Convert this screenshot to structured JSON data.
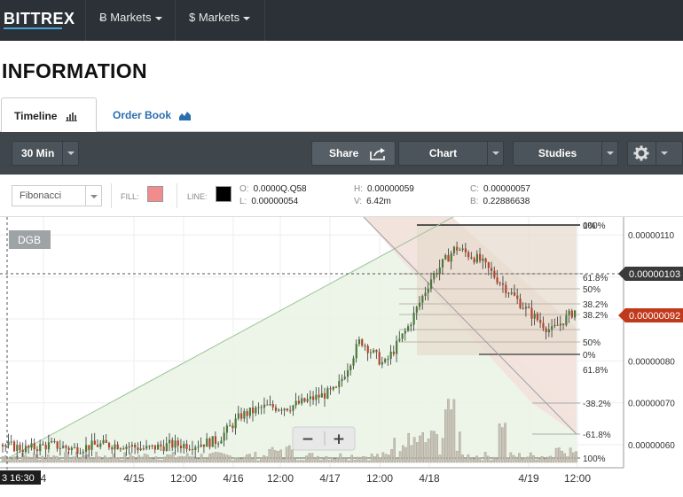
{
  "nav": {
    "brand": "BITTREX",
    "markets_btc": "Ƀ Markets",
    "markets_usd": "$ Markets"
  },
  "page": {
    "title": "INFORMATION"
  },
  "tabs": {
    "timeline": "Timeline",
    "order_book": "Order Book"
  },
  "toolbar": {
    "interval": "30 Min",
    "share": "Share",
    "chart": "Chart",
    "studies": "Studies"
  },
  "drawing": {
    "tool": "Fibonacci",
    "fill_label": "FILL:",
    "line_label": "LINE:",
    "fill_color": "#f08c8c",
    "line_color": "#000000"
  },
  "ohlc": {
    "o_label": "O:",
    "o_value": "0.0000Q.Q58",
    "l_label": "L:",
    "l_value": "0.00000054",
    "h_label": "H:",
    "h_value": "0.00000059",
    "v_label": "V:",
    "v_value": "6.42m",
    "c_label": "C:",
    "c_value": "0.00000057",
    "b_label": "B:",
    "b_value": "0.22886638"
  },
  "chart": {
    "symbol": "DGB",
    "crosshair_price": "0.00000103",
    "last_price": "0.00000092",
    "crosshair_time": "3 16:30",
    "accent_colors": {
      "last_price": "#c0391b",
      "crosshair": "#3a3a3a",
      "up": "#4a7a3a",
      "down": "#b5442a"
    },
    "fib_upper": [
      "100%",
      "61.8%",
      "50%",
      "38.2%",
      "0%"
    ],
    "fib_lower": [
      "0%",
      "38.2%",
      "50%",
      "61.8%",
      "100%"
    ],
    "fib_extra": [
      "61.8%",
      "-38.2%",
      "-61.8%",
      "100%"
    ],
    "zoom_out": "−",
    "zoom_in": "+"
  },
  "chart_data": {
    "type": "line",
    "title": "",
    "series": [],
    "x_ticks": [
      "4",
      "4/15",
      "12:00",
      "4/16",
      "12:00",
      "4/17",
      "12:00",
      "4/18",
      "4/19",
      "12:00"
    ],
    "y_ticks": [
      "0.00000110",
      "0.00000100",
      "0.00000090",
      "0.00000080",
      "0.00000070",
      "0.00000060"
    ],
    "ylim": [
      5.6e-07,
      1.13e-06
    ],
    "approx_close": [
      6e-07,
      5.9e-07,
      6e-07,
      5.9e-07,
      6e-07,
      6e-07,
      5.9e-07,
      6e-07,
      6e-07,
      6.1e-07,
      6.7e-07,
      6.9e-07,
      6.9e-07,
      7.1e-07,
      7.3e-07,
      8.5e-07,
      7.9e-07,
      8.8e-07,
      1e-06,
      1.07e-06,
      1.04e-06,
      9.8e-07,
      9.2e-07,
      8.7e-07,
      9.2e-07
    ],
    "grid": true
  }
}
